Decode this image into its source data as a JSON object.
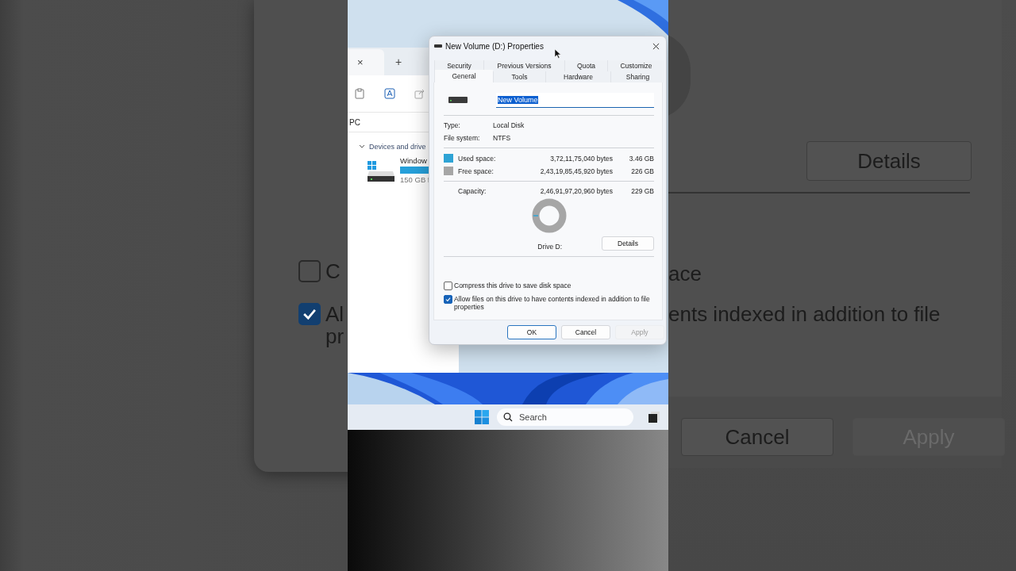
{
  "backdrop_left": {
    "checkboxes": [
      {
        "label": "C",
        "checked": false
      },
      {
        "label": "Al",
        "continuation": "pr",
        "checked": true
      }
    ]
  },
  "backdrop_right": {
    "details_button": "Details",
    "texts": [
      "ace",
      "ents indexed in addition to file"
    ],
    "buttons": [
      {
        "label": "Cancel",
        "disabled": false
      },
      {
        "label": "Apply",
        "disabled": true
      }
    ]
  },
  "explorer": {
    "tab_close": "×",
    "new_tab": "+",
    "address": "PC",
    "section": "Devices and drive",
    "drive": {
      "name": "Window",
      "detail": "150 GB f"
    }
  },
  "dialog": {
    "title": "New Volume (D:) Properties",
    "tab_rows": [
      [
        {
          "label": "Security",
          "selected": false
        },
        {
          "label": "Previous Versions",
          "selected": false
        },
        {
          "label": "Quota",
          "selected": false
        },
        {
          "label": "Customize",
          "selected": false
        }
      ],
      [
        {
          "label": "General",
          "selected": true
        },
        {
          "label": "Tools",
          "selected": false
        },
        {
          "label": "Hardware",
          "selected": false
        },
        {
          "label": "Sharing",
          "selected": false
        }
      ]
    ],
    "name_field": {
      "value": "New Volume",
      "selected": true
    },
    "info": [
      {
        "label": "Type:",
        "value": "Local Disk"
      },
      {
        "label": "File system:",
        "value": "NTFS"
      }
    ],
    "space": [
      {
        "label": "Used space:",
        "bytes": "3,72,11,75,040 bytes",
        "size": "3.46 GB",
        "color": "#2ea3d5"
      },
      {
        "label": "Free space:",
        "bytes": "2,43,19,85,45,920 bytes",
        "size": "226 GB",
        "color": "#a6a6a6"
      }
    ],
    "capacity": {
      "label": "Capacity:",
      "bytes": "2,46,91,97,20,960 bytes",
      "size": "229 GB"
    },
    "drive_label": "Drive D:",
    "details_button": "Details",
    "options": [
      {
        "label": "Compress this drive to save disk space",
        "checked": false
      },
      {
        "label": "Allow files on this drive to have contents indexed in addition to file properties",
        "checked": true
      }
    ],
    "buttons": [
      {
        "label": "OK",
        "default": true,
        "disabled": false
      },
      {
        "label": "Cancel",
        "default": false,
        "disabled": false
      },
      {
        "label": "Apply",
        "default": false,
        "disabled": true
      }
    ]
  },
  "taskbar": {
    "search": {
      "placeholder": "Search"
    }
  }
}
